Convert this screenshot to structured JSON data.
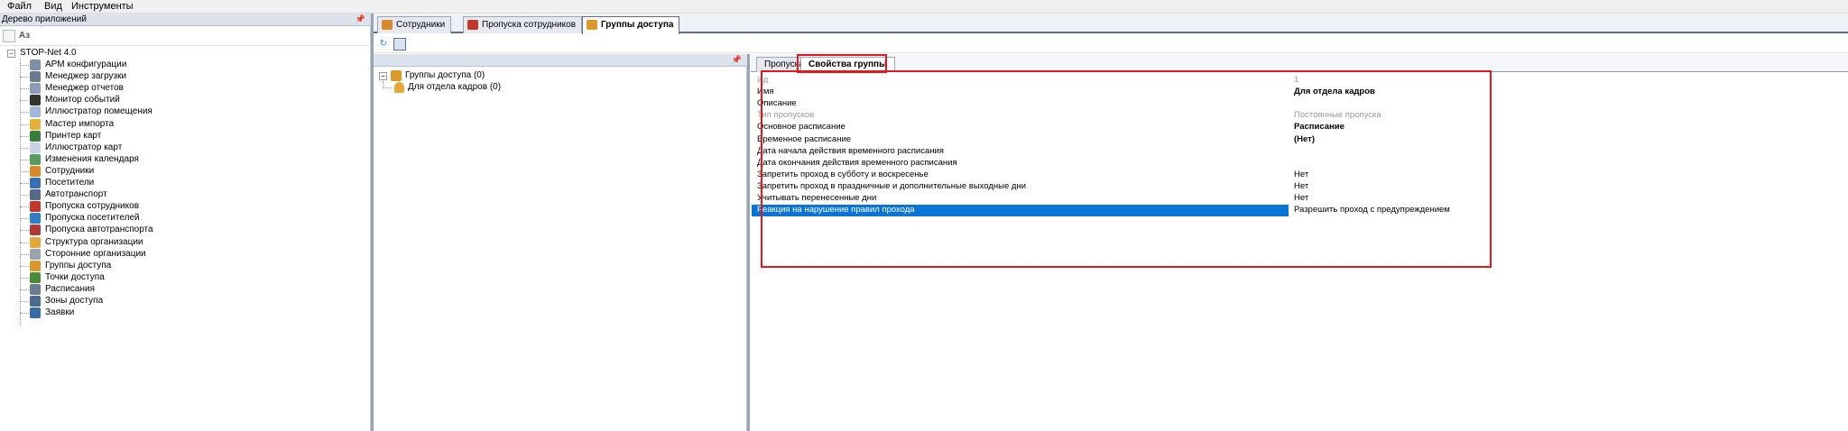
{
  "menu": {
    "file": "Файл",
    "view": "Вид",
    "tools": "Инструменты"
  },
  "app_tree": {
    "title": "Дерево приложений",
    "sort_icon_label": "Аз",
    "root": "STOP-Net 4.0",
    "items": [
      {
        "label": "АРМ конфигурации",
        "color": "#7f8fa6"
      },
      {
        "label": "Менеджер загрузки",
        "color": "#6b7b92"
      },
      {
        "label": "Менеджер отчетов",
        "color": "#8a9cb7"
      },
      {
        "label": "Монитор событий",
        "color": "#333333"
      },
      {
        "label": "Иллюстратор помещения",
        "color": "#9fb7d8"
      },
      {
        "label": "Мастер импорта",
        "color": "#e0b23a"
      },
      {
        "label": "Принтер карт",
        "color": "#3a7d3a"
      },
      {
        "label": "Иллюстратор карт",
        "color": "#c9d3e3"
      },
      {
        "label": "Изменения календаря",
        "color": "#5a9a5a"
      },
      {
        "label": "Сотрудники",
        "color": "#d98a2b"
      },
      {
        "label": "Посетители",
        "color": "#3b6fb5"
      },
      {
        "label": "Автотранспорт",
        "color": "#556a8a"
      },
      {
        "label": "Пропуска сотрудников",
        "color": "#c0392b"
      },
      {
        "label": "Пропуска посетителей",
        "color": "#2f7fc1"
      },
      {
        "label": "Пропуска автотранспорта",
        "color": "#b03a3a"
      },
      {
        "label": "Структура организации",
        "color": "#e2a83a"
      },
      {
        "label": "Сторонние организации",
        "color": "#9aa3ad"
      },
      {
        "label": "Группы доступа",
        "color": "#d99a2b"
      },
      {
        "label": "Точки доступа",
        "color": "#4a8a3a"
      },
      {
        "label": "Расписания",
        "color": "#6b7c93"
      },
      {
        "label": "Зоны доступа",
        "color": "#4a6a8a"
      },
      {
        "label": "Заявки",
        "color": "#3a6aa5"
      }
    ]
  },
  "doc_tabs": [
    {
      "label": "Сотрудники",
      "color": "#d98a2b"
    },
    {
      "label": "Пропуска сотрудников",
      "color": "#c0392b"
    },
    {
      "label": "Группы доступа",
      "color": "#d99a2b"
    }
  ],
  "groups_tree": {
    "root": "Группы доступа (0)",
    "child": "Для отдела кадров (0)"
  },
  "sub_tabs": {
    "passes": "Пропуска",
    "group_props": "Свойства группы"
  },
  "properties": [
    {
      "name": "Ид",
      "value": "1",
      "state": "disabled"
    },
    {
      "name": "Имя",
      "value": "Для отдела кадров",
      "state": "bold"
    },
    {
      "name": "Описание",
      "value": "",
      "state": "normal"
    },
    {
      "name": "Тип пропусков",
      "value": "Постоянные пропуска",
      "state": "disabled"
    },
    {
      "name": "Основное расписание",
      "value": "Расписание",
      "state": "bold"
    },
    {
      "name": "Временное расписание",
      "value": "(Нет)",
      "state": "bold"
    },
    {
      "name": "Дата начала действия временного расписания",
      "value": "",
      "state": "normal"
    },
    {
      "name": "Дата окончания действия временного расписания",
      "value": "",
      "state": "normal"
    },
    {
      "name": "Запретить проход в субботу и воскресенье",
      "value": "Нет",
      "state": "normal"
    },
    {
      "name": "Запретить проход в праздничные и дополнительные выходные дни",
      "value": "Нет",
      "state": "normal"
    },
    {
      "name": "Учитывать перенесенные дни",
      "value": "Нет",
      "state": "normal"
    },
    {
      "name": "Реакция на нарушение правил прохода",
      "value": "Разрешить проход с предупреждением",
      "state": "selected"
    }
  ],
  "colors": {
    "selection": "#0a74d6",
    "highlight": "#e0181f",
    "pane_header": "#dde3ec"
  }
}
